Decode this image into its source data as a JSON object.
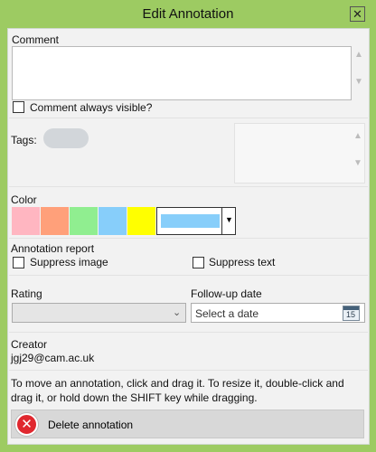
{
  "window": {
    "title": "Edit Annotation",
    "close_glyph": "✕"
  },
  "comment": {
    "label": "Comment",
    "value": "",
    "always_visible_label": "Comment always visible?",
    "always_visible_checked": false
  },
  "tags": {
    "label": "Tags:"
  },
  "color": {
    "label": "Color",
    "swatches": [
      "#ffb6c1",
      "#ffa07a",
      "#90ee90",
      "#87cefa",
      "#ffff00"
    ],
    "selected": "#87cefa"
  },
  "report": {
    "label": "Annotation report",
    "suppress_image_label": "Suppress image",
    "suppress_text_label": "Suppress text"
  },
  "rating": {
    "label": "Rating",
    "value": ""
  },
  "followup": {
    "label": "Follow-up date",
    "placeholder": "Select a date",
    "calendar_day": "15"
  },
  "creator": {
    "label": "Creator",
    "value": "jgj29@cam.ac.uk"
  },
  "help": {
    "text": "To move an annotation, click and drag it. To resize it, double-click and drag it, or hold down the SHIFT key while dragging."
  },
  "delete": {
    "label": "Delete annotation"
  },
  "icons": {
    "close": "close-icon",
    "scroll_up": "scroll-up-icon",
    "scroll_down": "scroll-down-icon",
    "dropdown": "chevron-down-icon",
    "calendar": "calendar-icon",
    "delete": "delete-icon"
  }
}
